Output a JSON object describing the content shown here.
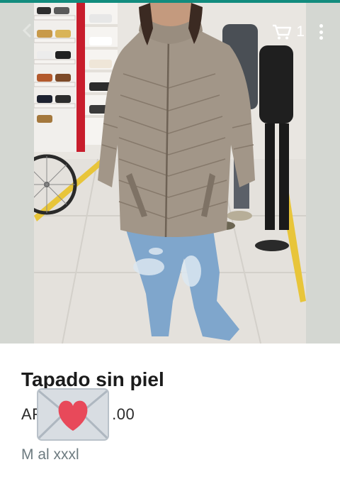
{
  "header": {
    "cart_count": "1",
    "icons": [
      "back-arrow-icon",
      "cart-icon",
      "more-vertical-icon"
    ],
    "accent_color": "#128c7e"
  },
  "product": {
    "image_description_icon": "product-photo",
    "title": "Tapado sin piel",
    "price_prefix": "AF",
    "price_suffix": ".00",
    "description": "M al xxxl"
  },
  "sticker": {
    "icon": "love-letter-envelope-icon",
    "heart_color": "#e8495a"
  }
}
